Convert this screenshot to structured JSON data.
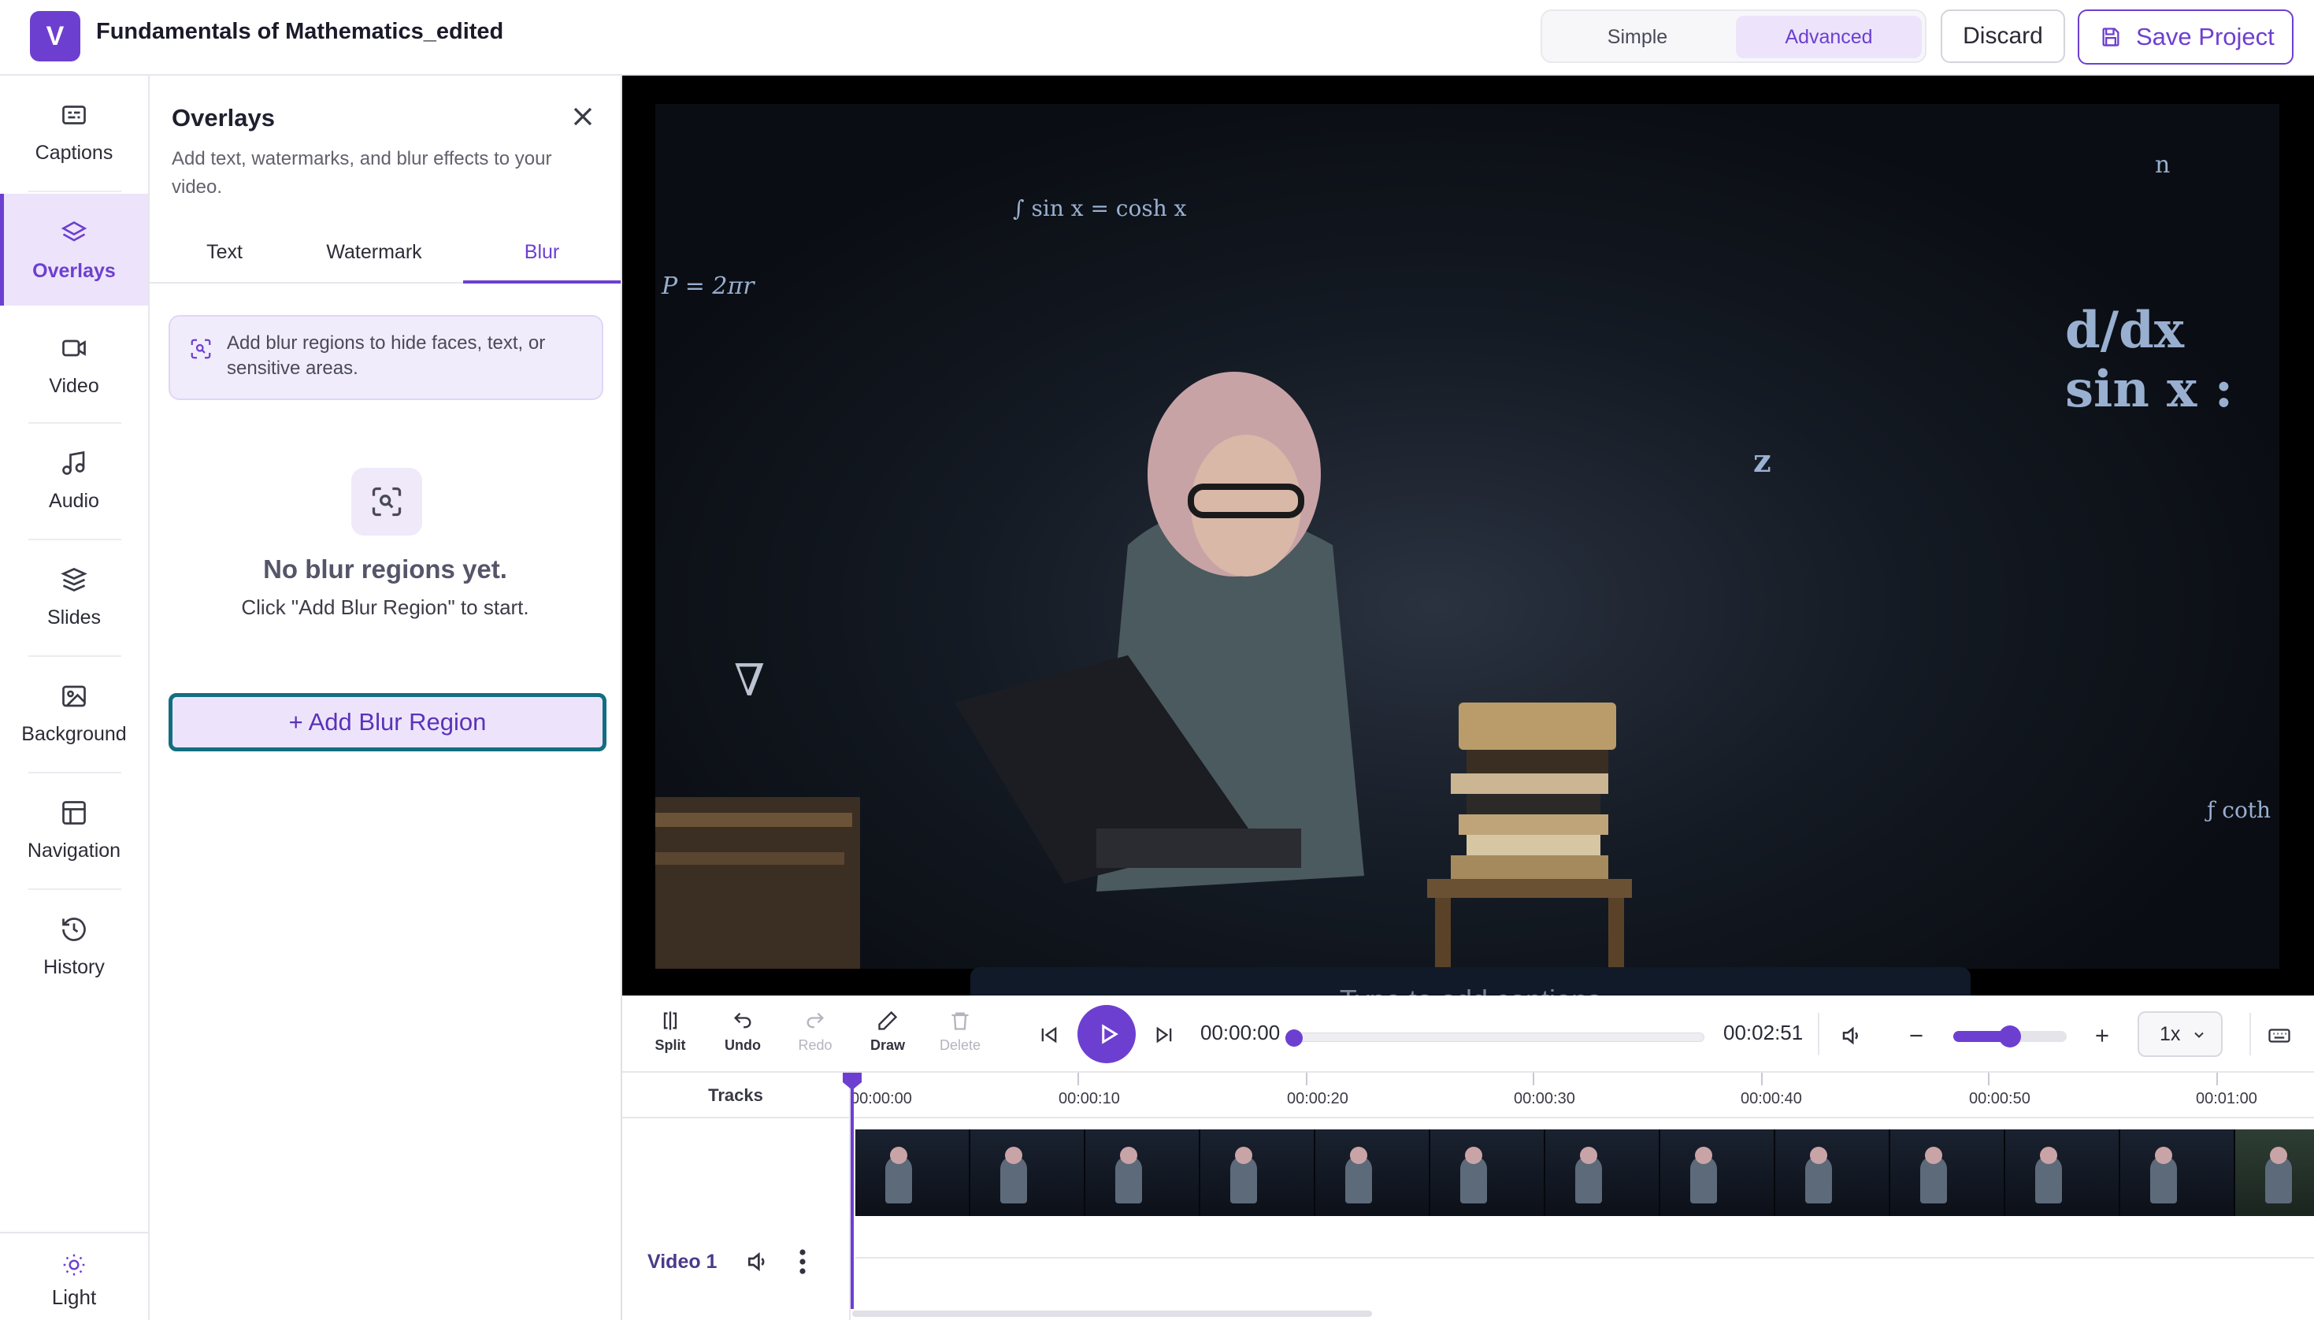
{
  "app": {
    "logo_letter": "V",
    "project_title": "Fundamentals of Mathematics_edited",
    "brand_color": "#6d3fd1"
  },
  "header": {
    "mode_simple": "Simple",
    "mode_advanced": "Advanced",
    "active_mode": "Advanced",
    "discard_label": "Discard",
    "save_label": "Save Project"
  },
  "rail": {
    "items": [
      {
        "label": "Captions",
        "icon": "captions-icon"
      },
      {
        "label": "Overlays",
        "icon": "layers-icon",
        "active": true
      },
      {
        "label": "Video",
        "icon": "video-camera-icon"
      },
      {
        "label": "Audio",
        "icon": "music-note-icon"
      },
      {
        "label": "Slides",
        "icon": "stack-icon"
      },
      {
        "label": "Background",
        "icon": "image-icon"
      },
      {
        "label": "Navigation",
        "icon": "layout-icon"
      },
      {
        "label": "History",
        "icon": "history-icon"
      }
    ],
    "theme_label": "Light",
    "theme_icon": "sun-icon"
  },
  "panel": {
    "title": "Overlays",
    "description": "Add text, watermarks, and blur effects to your video.",
    "tabs": [
      "Text",
      "Watermark",
      "Blur"
    ],
    "active_tab": "Blur",
    "info_text": "Add blur regions to hide faces, text, or sensitive areas.",
    "empty_title": "No blur regions yet.",
    "empty_subtitle": "Click \"Add Blur Region\" to start.",
    "add_button_label": "+  Add Blur Region"
  },
  "video": {
    "caption_placeholder": "Type to add captions",
    "math": [
      "d/dx sin x :",
      "P = 2πr",
      "z",
      "∫ sin x = cosh x",
      "ƒ coth",
      "∇",
      "n"
    ]
  },
  "controls": {
    "tools": [
      {
        "label": "Split",
        "icon": "split-icon",
        "enabled": true
      },
      {
        "label": "Undo",
        "icon": "undo-icon",
        "enabled": true
      },
      {
        "label": "Redo",
        "icon": "redo-icon",
        "enabled": false
      },
      {
        "label": "Draw",
        "icon": "pencil-icon",
        "enabled": true
      },
      {
        "label": "Delete",
        "icon": "trash-icon",
        "enabled": false
      }
    ],
    "current_time": "00:00:00",
    "total_time": "00:02:51",
    "playback_progress": 0,
    "speed": "1x",
    "volume_level": 0.5
  },
  "timeline": {
    "tracks_header": "Tracks",
    "ruler": [
      "00:00:00",
      "00:00:10",
      "00:00:20",
      "00:00:30",
      "00:00:40",
      "00:00:50",
      "00:01:00"
    ],
    "track_name": "Video 1"
  }
}
